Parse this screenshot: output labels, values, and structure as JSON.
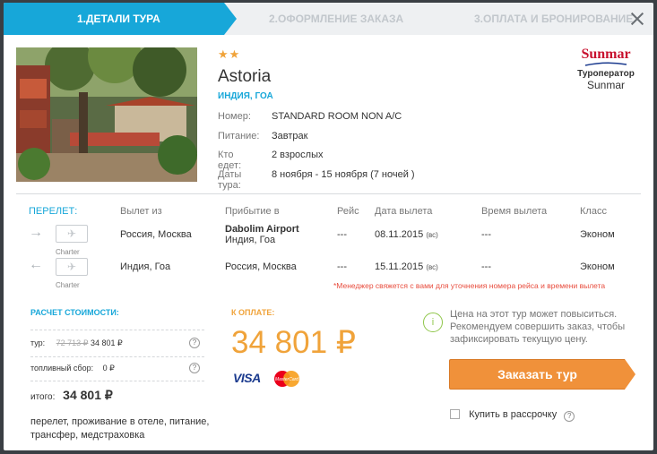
{
  "steps": {
    "step1": "1.Детали тура",
    "step2": "2.Оформление заказа",
    "step3": "3.Оплата и бронирование"
  },
  "hotel": {
    "stars": "★★",
    "name": "Astoria",
    "location": "Индия, Гоа"
  },
  "details": [
    {
      "label": "Номер:",
      "value": "STANDARD ROOM NON A/C"
    },
    {
      "label": "Питание:",
      "value": "Завтрак"
    },
    {
      "label": "Кто едет:",
      "value": "2 взрослых"
    },
    {
      "label": "Даты тура:",
      "value": "8 ноября - 15 ноября (7 ночей )"
    }
  ],
  "operator": {
    "logo": "Sunmar",
    "label": "Туроператор",
    "name": "Sunmar"
  },
  "flights": {
    "headers": {
      "flight": "ПЕРЕЛЕТ:",
      "from": "Вылет из",
      "to": "Прибытие в",
      "number": "Рейс",
      "date": "Дата вылета",
      "time": "Время вылета",
      "class": "Класс"
    },
    "rows": [
      {
        "arrow": "→",
        "type": "Charter",
        "from": "Россия, Москва",
        "airport": "Dabolim Airport",
        "to": "Индия, Гоа",
        "number": "---",
        "date": "08.11.2015",
        "day": "(вс)",
        "time": "---",
        "class": "Эконом"
      },
      {
        "arrow": "←",
        "type": "Charter",
        "from": "Индия, Гоа",
        "airport": "",
        "to": "Россия, Москва",
        "number": "---",
        "date": "15.11.2015",
        "day": "(вс)",
        "time": "---",
        "class": "Эконом"
      }
    ],
    "note": "*Менеджер свяжется с вами для уточнения номера рейса и времени вылета"
  },
  "calc": {
    "title": "Расчет стоимости:",
    "tour_label": "тур:",
    "tour_old": "72 713 ₽",
    "tour_new": "34 801 ₽",
    "fuel_label": "топливный сбор:",
    "fuel_value": "0 ₽",
    "total_label": "итого:",
    "total_value": "34 801 ₽",
    "includes": "перелет, проживание в отеле, питание, трансфер, медстраховка",
    "help": "?"
  },
  "payment": {
    "title": "К оплате:",
    "amount": "34 801 ₽",
    "visa": "VISA",
    "mastercard": "MasterCard"
  },
  "notice": {
    "icon": "i",
    "text": "Цена на этот тур может повыситься. Рекомендуем совершить заказ, чтобы зафиксировать текущую цену."
  },
  "actions": {
    "order": "Заказать тур",
    "installment": "Купить в рассрочку"
  },
  "colors": {
    "accent": "#17a7d9",
    "price": "#f0a33a",
    "button": "#f0913a",
    "note": "#e84c3d"
  }
}
